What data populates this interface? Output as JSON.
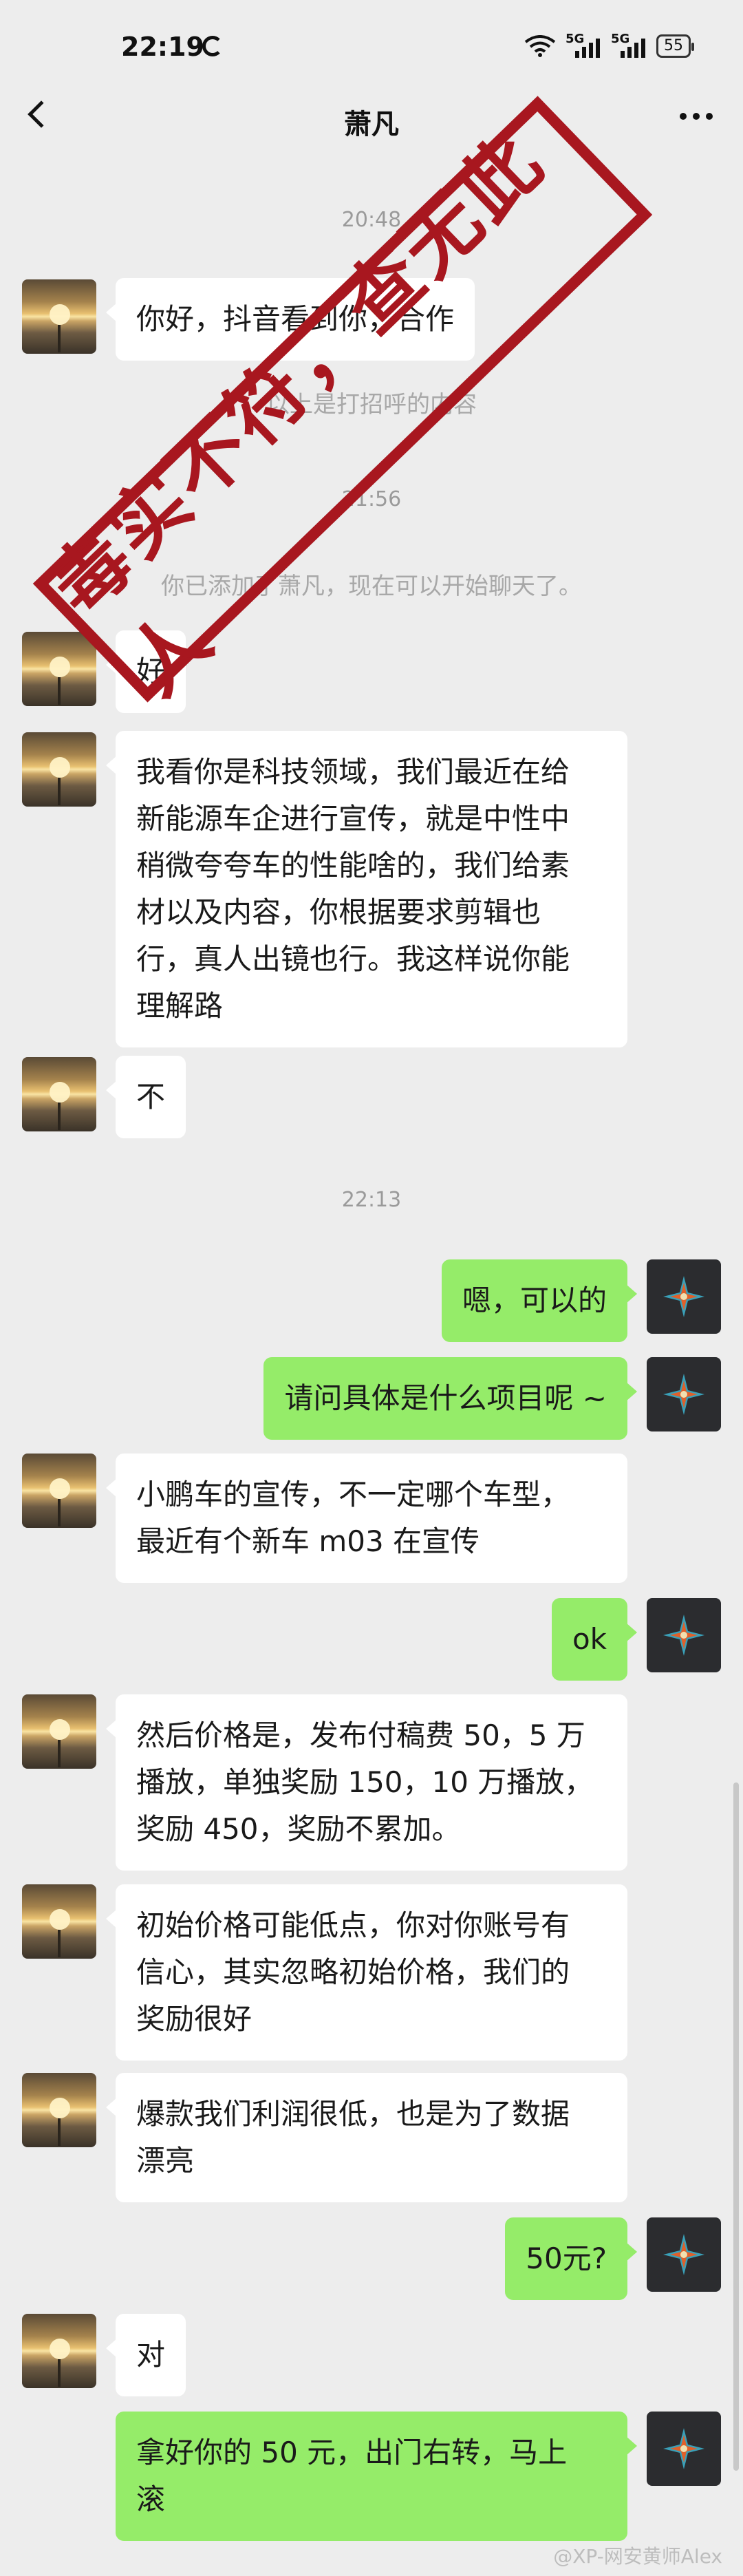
{
  "status": {
    "time": "22:19",
    "signal1": "5G",
    "signal2": "5G",
    "battery": "55"
  },
  "header": {
    "title": "萧凡"
  },
  "chat": {
    "ts1": "20:48",
    "m1": "你好，抖音看到你，合作",
    "sys1": "以上是打招呼的内容",
    "ts2": "21:56",
    "sys2": "你已添加了萧凡，现在可以开始聊天了。",
    "m2": "好",
    "m3": "我看你是科技领域，我们最近在给\n新能源车企进行宣传，就是中性中\n稍微夸夸车的性能啥的，我们给素\n材以及内容，你根据要求剪辑也\n行，真人出镜也行。我这样说你能\n理解路",
    "m4": "不",
    "ts3": "22:13",
    "r1": "嗯，可以的",
    "r2": "请问具体是什么项目呢 ~",
    "m5": "小鹏车的宣传，不一定哪个车型，\n最近有个新车 m03 在宣传",
    "r3": "ok",
    "m6": "然后价格是，发布付稿费 50，5 万\n播放，单独奖励 150，10 万播放，\n奖励 450，奖励不累加。",
    "m7": "初始价格可能低点，你对你账号有\n信心，其实忽略初始价格，我们的\n奖励很好",
    "m8": "爆款我们利润很低，也是为了数据\n漂亮",
    "r4": "50元?",
    "m9": "对",
    "r5": "拿好你的 50 元，出门右转，马上\n滚"
  },
  "stamp": {
    "text": "毒实不符，查无此人",
    "color": "#a8171f"
  },
  "watermark": "@XP-网安黄师Alex",
  "colors": {
    "bg": "#ededed",
    "self_bubble": "#95ec69",
    "other_bubble": "#ffffff"
  }
}
